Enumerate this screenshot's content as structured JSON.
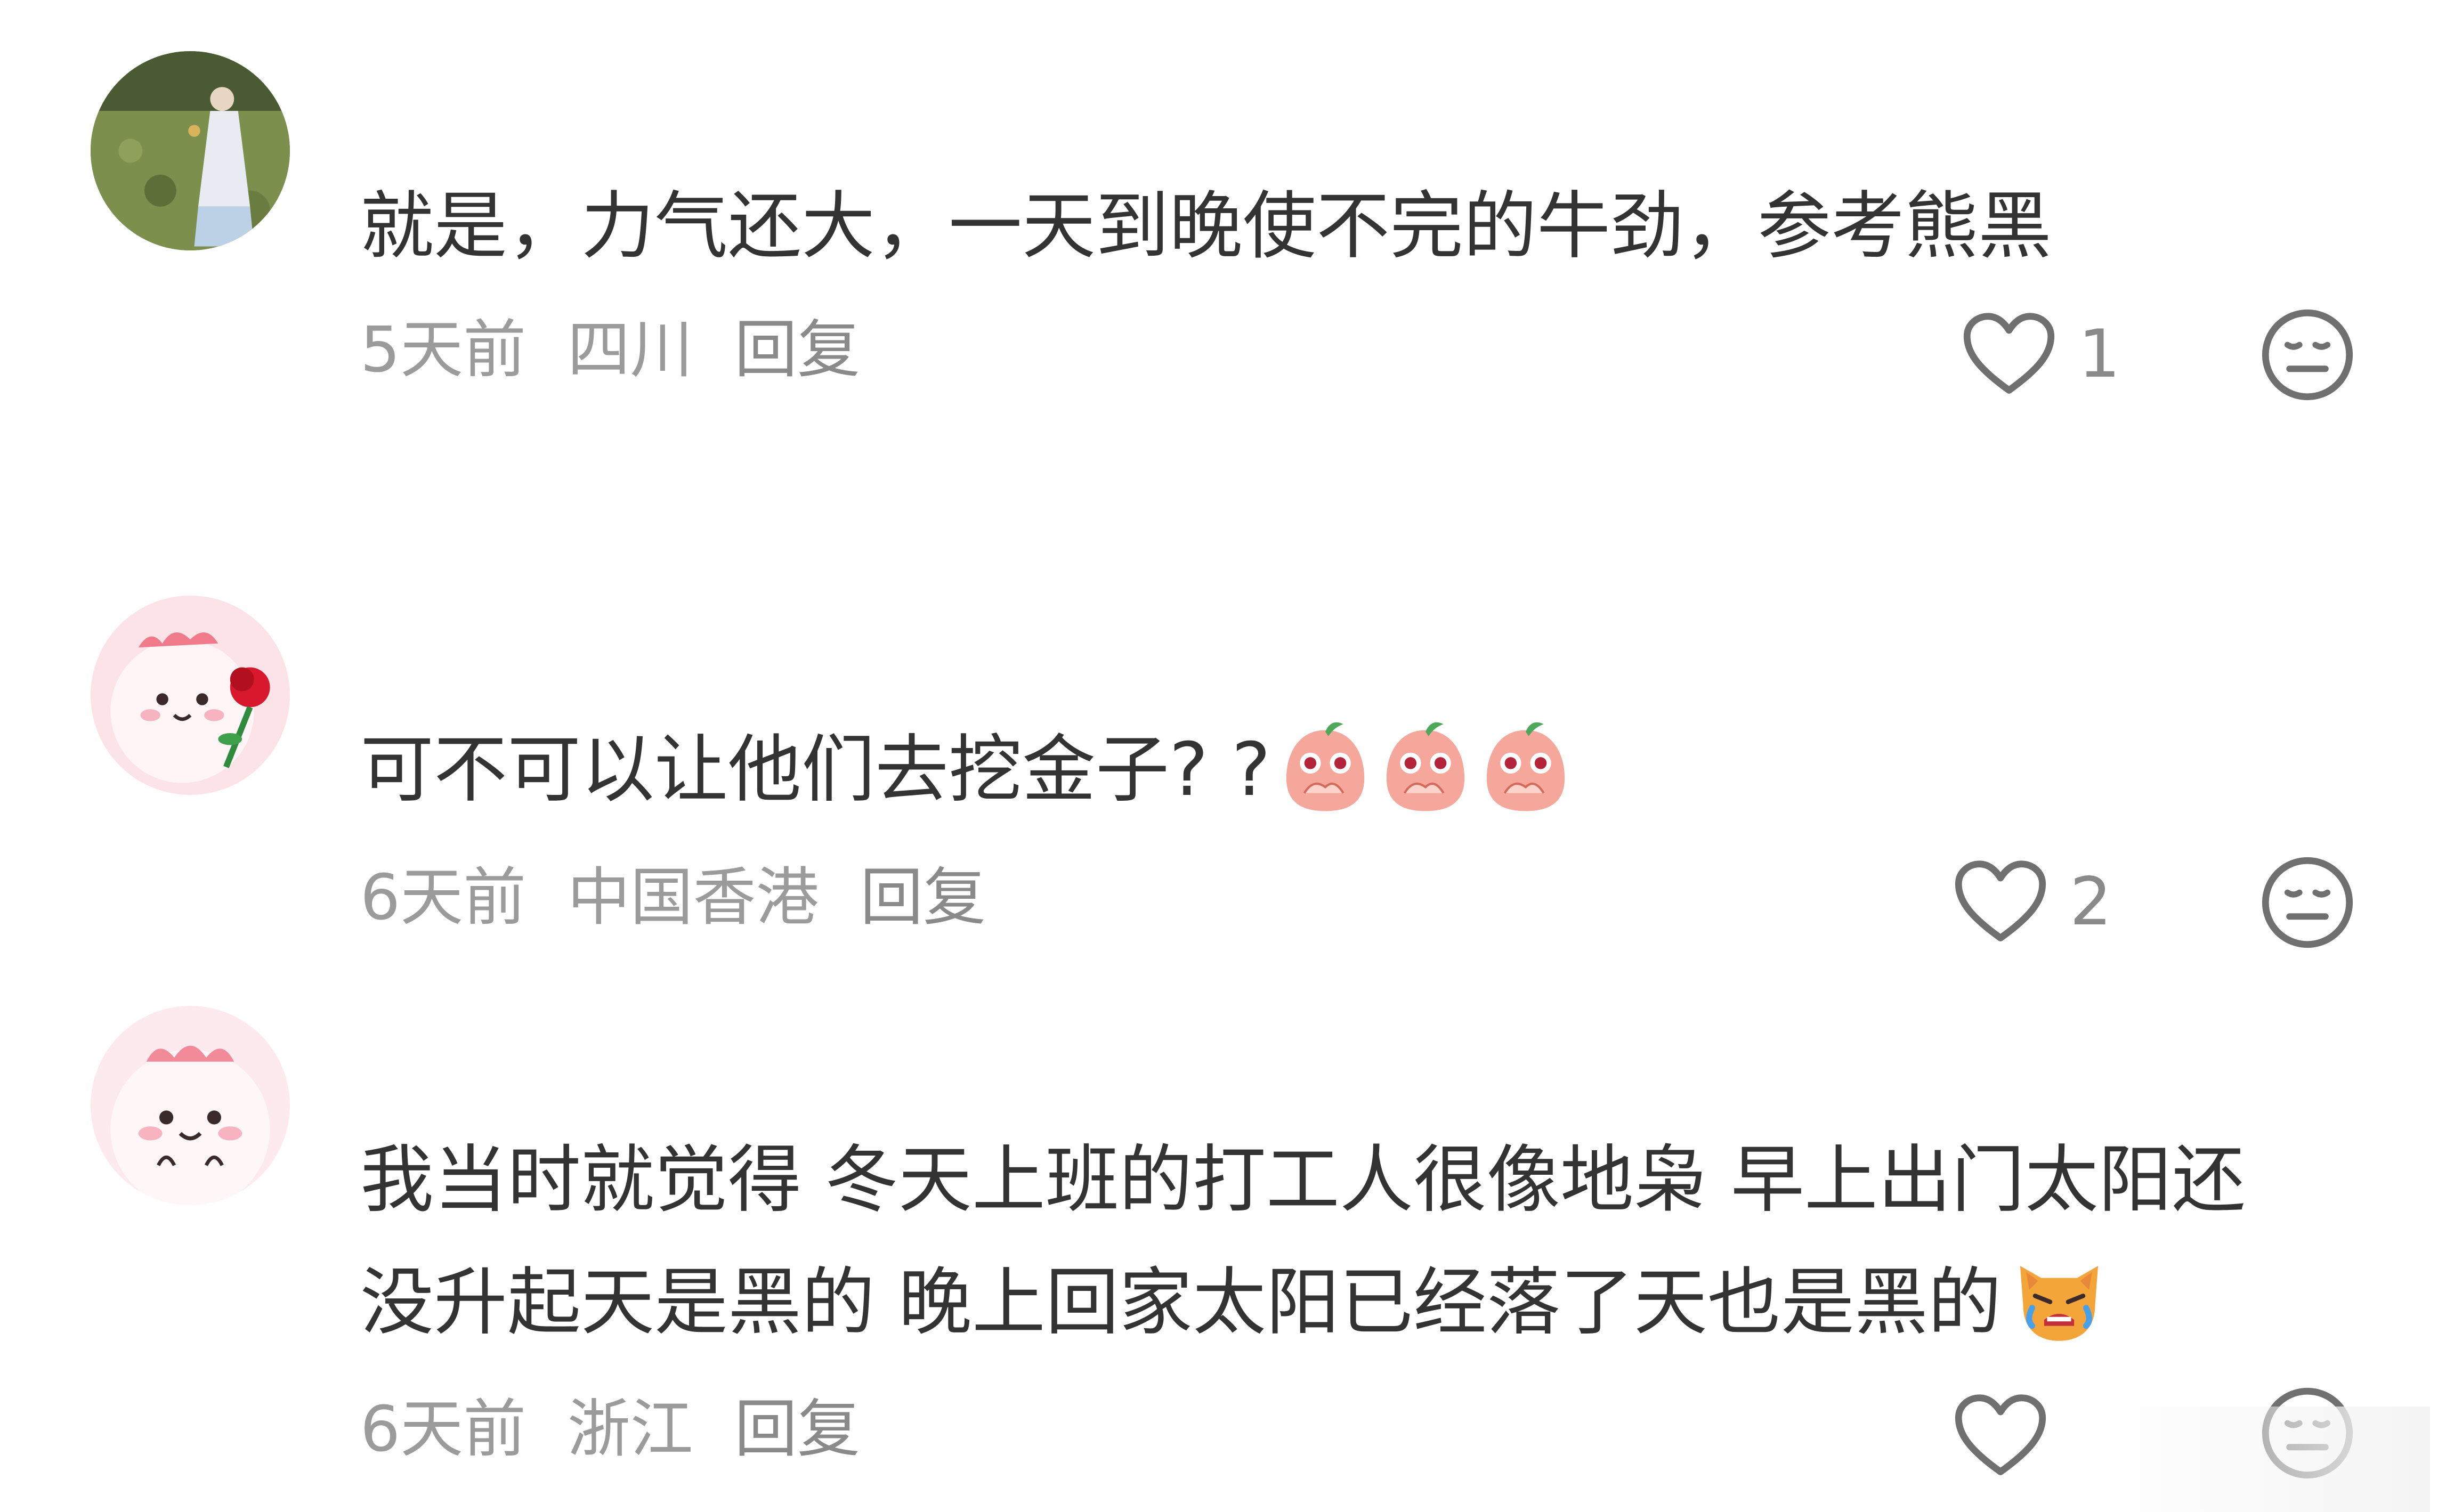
{
  "comments": [
    {
      "avatar": "avatar-photo-girl-field",
      "text": "就是，力气还大，一天到晚使不完的牛劲，参考熊黑",
      "time": "5天前",
      "location": "四川",
      "reply_label": "回复",
      "likes": "1"
    },
    {
      "avatar": "avatar-pink-dino-rose",
      "text": "可不可以让他们去挖金子? ?",
      "emojis": [
        "peach-shocked-emoji",
        "peach-shocked-emoji",
        "peach-shocked-emoji"
      ],
      "time": "6天前",
      "location": "中国香港",
      "reply_label": "回复",
      "likes": "2"
    },
    {
      "avatar": "avatar-pink-dino",
      "text_line1": "我当时就觉得 冬天上班的打工人很像地枭  早上出门太阳还",
      "text_line2": "没升起天是黑的 晚上回家太阳已经落了天也是黑的",
      "emoji": "angry-cat-crying-emoji",
      "time": "6天前",
      "location": "浙江",
      "reply_label": "回复",
      "likes": ""
    }
  ],
  "colors": {
    "text": "#333333",
    "meta": "#9b9b9b",
    "icon": "#707070"
  }
}
